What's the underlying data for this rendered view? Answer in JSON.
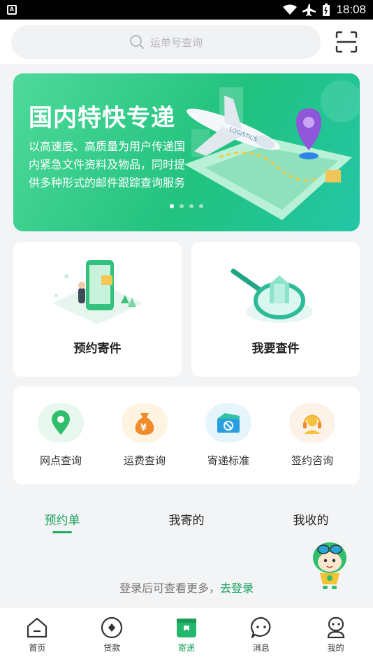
{
  "status_bar": {
    "time": "18:08"
  },
  "search": {
    "placeholder": "运单号查询"
  },
  "banner": {
    "title": "国内特快专递",
    "description": "以高速度、高质量为用户传递国内紧急文件资料及物品，同时提供多种形式的邮件跟踪查询服务",
    "art_text": "LOGISTICS",
    "slides": 4,
    "active_slide": 1
  },
  "cards": [
    {
      "label": "预约寄件",
      "icon": "phone-package-illustration"
    },
    {
      "label": "我要查件",
      "icon": "magnifier-package-illustration"
    }
  ],
  "services": [
    {
      "label": "网点查询",
      "icon": "location-pin-icon",
      "color": "#2fbf6c",
      "bg": "#e8f8ee"
    },
    {
      "label": "运费查询",
      "icon": "money-bag-icon",
      "color": "#f08a2a",
      "bg": "#fff3e2"
    },
    {
      "label": "寄递标准",
      "icon": "package-box-icon",
      "color": "#2a9fe0",
      "bg": "#e6f5fc"
    },
    {
      "label": "签约咨询",
      "icon": "headset-icon",
      "color": "#f4b53a",
      "bg": "#fdf2e8"
    }
  ],
  "tabs": [
    {
      "label": "预约单",
      "active": true
    },
    {
      "label": "我寄的",
      "active": false
    },
    {
      "label": "我收的",
      "active": false
    }
  ],
  "login_hint": {
    "text": "登录后可查看更多，",
    "link": "去登录"
  },
  "bottom_nav": [
    {
      "label": "首页",
      "icon": "home-icon",
      "active": false
    },
    {
      "label": "贷款",
      "icon": "loan-icon",
      "active": false
    },
    {
      "label": "寄递",
      "icon": "mail-icon",
      "active": true
    },
    {
      "label": "消息",
      "icon": "message-icon",
      "active": false
    },
    {
      "label": "我的",
      "icon": "profile-icon",
      "active": false
    }
  ],
  "colors": {
    "brand_green": "#17a35d",
    "banner_start": "#4fd99a",
    "banner_end": "#23c6a6"
  }
}
